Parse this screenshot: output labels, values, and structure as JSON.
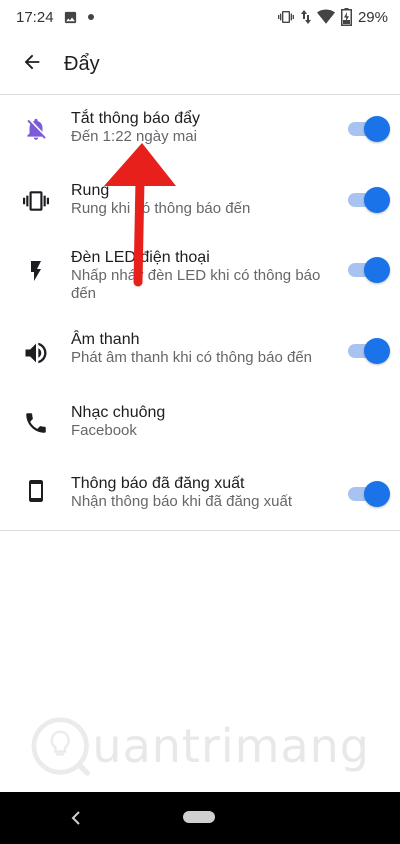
{
  "status_bar": {
    "time": "17:24",
    "battery": "29%",
    "icons": [
      "image-icon",
      "dot-icon",
      "vibrate-icon",
      "wifi-icon",
      "battery-icon"
    ]
  },
  "header": {
    "title": "Đẩy",
    "back_icon": "arrow-left-icon"
  },
  "settings": [
    {
      "id": "mute",
      "icon": "bell-off-icon",
      "title": "Tắt thông báo đẩy",
      "subtitle": "Đến 1:22 ngày mai",
      "toggle": true
    },
    {
      "id": "vibrate",
      "icon": "vibrate-phone-icon",
      "title": "Rung",
      "subtitle": "Rung khi có thông báo đến",
      "toggle": true
    },
    {
      "id": "led",
      "icon": "lightning-icon",
      "title": "Đèn LED điện thoại",
      "subtitle": "Nhấp nháy đèn LED khi có thông báo đến",
      "toggle": true
    },
    {
      "id": "sound",
      "icon": "speaker-icon",
      "title": "Âm thanh",
      "subtitle": "Phát âm thanh khi có thông báo đến",
      "toggle": true
    },
    {
      "id": "ringtone",
      "icon": "phone-icon",
      "title": "Nhạc chuông",
      "subtitle": "Facebook",
      "toggle": null
    },
    {
      "id": "logged_out",
      "icon": "smartphone-icon",
      "title": "Thông báo đã đăng xuất",
      "subtitle": "Nhận thông báo khi đã đăng xuất",
      "toggle": true
    }
  ],
  "watermark": "uantrimang",
  "colors": {
    "accent": "#1a73e8",
    "track": "#a8c3ef",
    "mute_icon": "#7b5cd6",
    "annotation": "#e8201c",
    "nav_bar": "#000000"
  }
}
